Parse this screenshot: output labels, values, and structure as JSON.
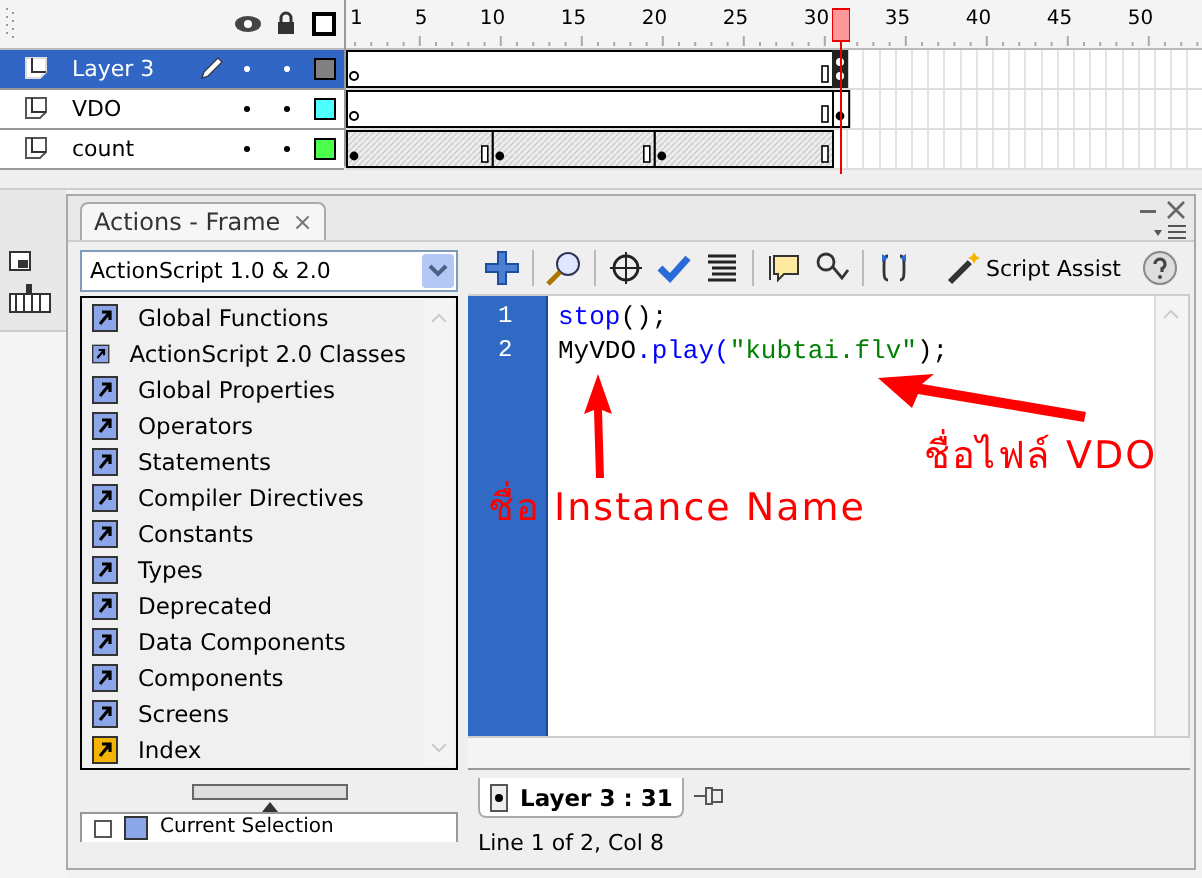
{
  "timeline": {
    "ruler": [
      "1",
      "5",
      "10",
      "15",
      "20",
      "25",
      "30",
      "35",
      "40",
      "45",
      "50"
    ],
    "playhead": {
      "level": 0.575
    },
    "layers": [
      {
        "name": "Layer 3",
        "selected": true,
        "color": "#808080",
        "kind": "script"
      },
      {
        "name": "VDO",
        "selected": false,
        "color": "#4dffff",
        "kind": "video"
      },
      {
        "name": "count",
        "selected": false,
        "color": "#4dff4d",
        "kind": "tween"
      }
    ]
  },
  "actions_panel": {
    "tab": {
      "label": "Actions - Frame",
      "close": "×"
    },
    "version_dropdown": {
      "value": "ActionScript 1.0 & 2.0"
    },
    "toolbox": [
      {
        "label": "Global Functions",
        "kind": "book"
      },
      {
        "label": "ActionScript 2.0 Classes",
        "kind": "book"
      },
      {
        "label": "Global Properties",
        "kind": "book"
      },
      {
        "label": "Operators",
        "kind": "book"
      },
      {
        "label": "Statements",
        "kind": "book"
      },
      {
        "label": "Compiler Directives",
        "kind": "book"
      },
      {
        "label": "Constants",
        "kind": "book"
      },
      {
        "label": "Types",
        "kind": "book"
      },
      {
        "label": "Deprecated",
        "kind": "book"
      },
      {
        "label": "Data Components",
        "kind": "book"
      },
      {
        "label": "Components",
        "kind": "book"
      },
      {
        "label": "Screens",
        "kind": "book"
      },
      {
        "label": "Index",
        "kind": "index"
      }
    ],
    "current_selection": "Current Selection",
    "script_assist": "Script Assist",
    "code": [
      {
        "number": "1",
        "tokens": [
          {
            "text": "stop",
            "kind": "keyword"
          },
          {
            "text": "();",
            "kind": "plain"
          }
        ]
      },
      {
        "number": "2",
        "tokens": [
          {
            "text": "MyVDO",
            "kind": "plain"
          },
          {
            "text": ".play(",
            "kind": "keyword"
          },
          {
            "text": "\"kubtai.flv\"",
            "kind": "string"
          },
          {
            "text": ");",
            "kind": "plain"
          }
        ]
      }
    ],
    "annotations": [
      {
        "text": "ชื่อ Instance Name",
        "kind": "instance"
      },
      {
        "text": "ชื่อไฟล์ VDO",
        "kind": "file"
      }
    ],
    "script_tab": "Layer 3 : 31",
    "status": "Line 1 of 2, Col 8"
  }
}
